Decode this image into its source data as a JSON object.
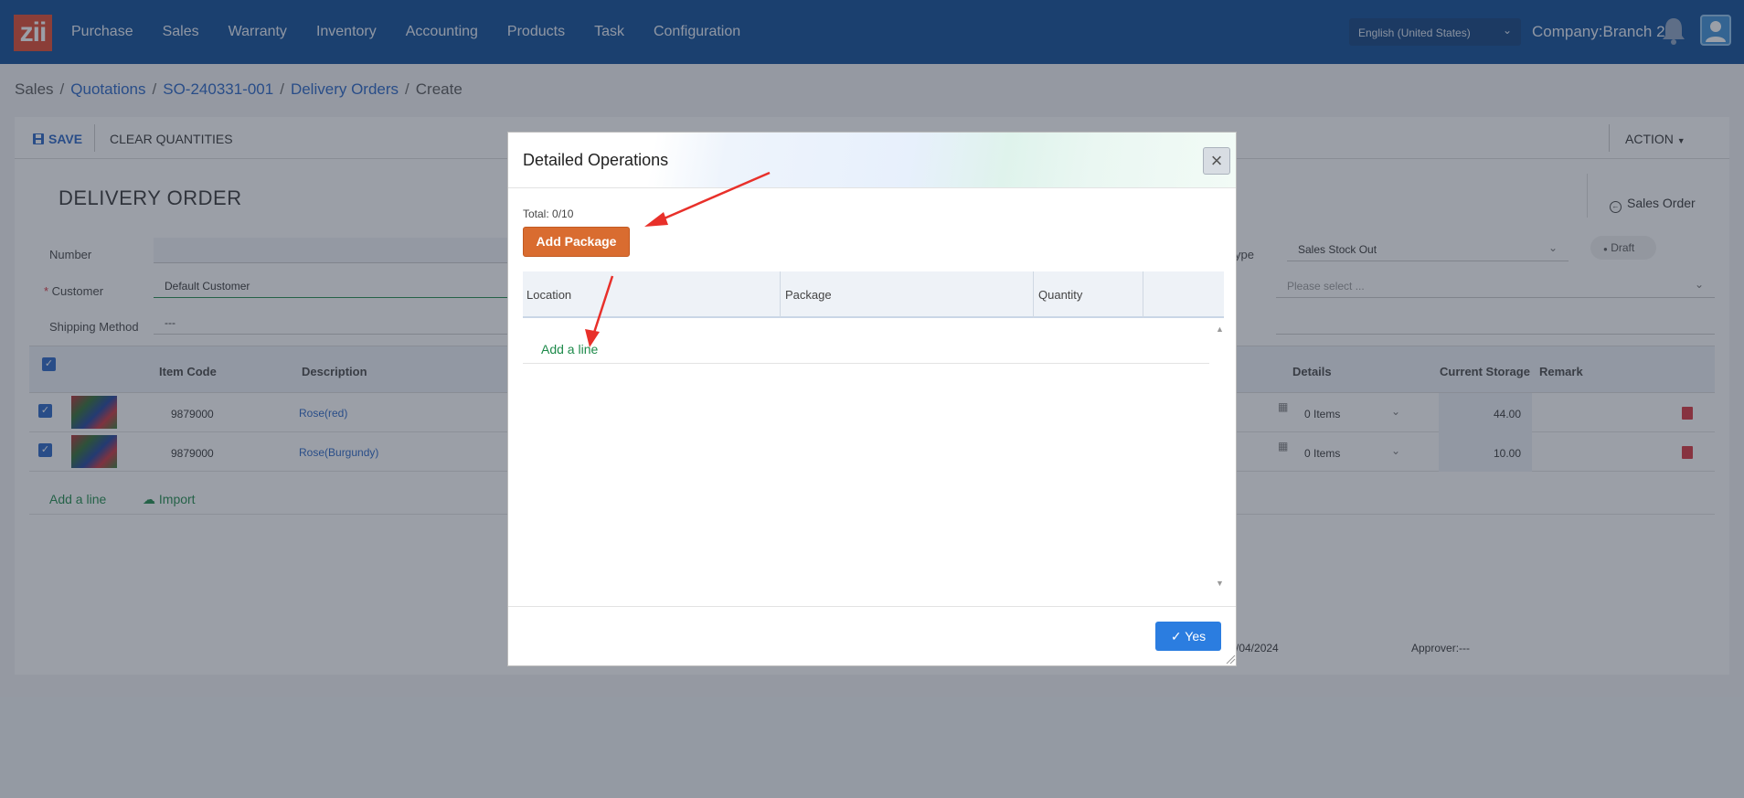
{
  "app": {
    "logo_text": "zii",
    "nav": [
      "Purchase",
      "Sales",
      "Warranty",
      "Inventory",
      "Accounting",
      "Products",
      "Task",
      "Configuration"
    ],
    "language": "English (United States)",
    "company": "Company:Branch 2"
  },
  "breadcrumb": {
    "items": [
      "Sales",
      "Quotations",
      "SO-240331-001",
      "Delivery Orders",
      "Create"
    ],
    "separator": "/"
  },
  "toolbar": {
    "save_label": "SAVE",
    "clear_label": "CLEAR QUANTITIES",
    "action_label": "ACTION"
  },
  "form": {
    "title": "DELIVERY ORDER",
    "sales_order_link": "Sales Order",
    "number_label": "Number",
    "customer_label": "Customer",
    "customer_value": "Default Customer",
    "shipping_label": "Shipping Method",
    "shipping_value": "---",
    "type_label_partial": "ype",
    "type_value": "Sales Stock Out",
    "select_placeholder": "Please select ...",
    "status": "Draft"
  },
  "grid": {
    "headers": [
      "Item Code",
      "Description",
      "Details",
      "Current Storage",
      "Remark"
    ],
    "rows": [
      {
        "code": "9879000",
        "description": "Rose(red)",
        "details": "0 Items",
        "storage": "44.00"
      },
      {
        "code": "9879000",
        "description": "Rose(Burgundy)",
        "details": "0 Items",
        "storage": "10.00"
      }
    ],
    "add_line": "Add a line",
    "import": "Import"
  },
  "footer": {
    "date_partial": "/04/2024",
    "approver": "Approver:---"
  },
  "modal": {
    "title": "Detailed Operations",
    "total": "Total: 0/10",
    "add_package": "Add Package",
    "columns": [
      "Location",
      "Package",
      "Quantity"
    ],
    "add_line": "Add a line",
    "yes": "Yes"
  },
  "colors": {
    "nav_bg": "#0a4a94",
    "accent_blue": "#2563c4",
    "add_package": "#d96c30",
    "add_line_green": "#1d8a4a",
    "arrow_red": "#e8302a"
  }
}
